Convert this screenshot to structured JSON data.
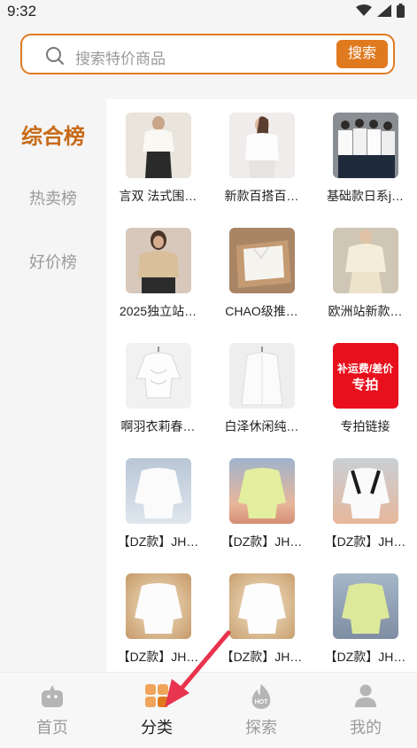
{
  "status": {
    "time": "9:32"
  },
  "search": {
    "placeholder": "搜索特价商品",
    "button_label": "搜索"
  },
  "sidebar": {
    "items": [
      {
        "label": "综合榜",
        "active": true
      },
      {
        "label": "热卖榜",
        "active": false
      },
      {
        "label": "好价榜",
        "active": false
      }
    ]
  },
  "products": [
    {
      "title": "言双 法式围…",
      "thumb": "woman-white-shirt-black-skirt"
    },
    {
      "title": "新款百搭百…",
      "thumb": "woman-white-blouse"
    },
    {
      "title": "基础款日系j…",
      "thumb": "group-students"
    },
    {
      "title": "2025独立站…",
      "thumb": "woman-satin-blouse"
    },
    {
      "title": "CHAO级推…",
      "thumb": "shirt-in-box"
    },
    {
      "title": "欧洲站新款…",
      "thumb": "woman-cream-blouse"
    },
    {
      "title": "啊羽衣莉春…",
      "thumb": "white-ruched-top"
    },
    {
      "title": "白泽休闲纯…",
      "thumb": "white-shirt-hanger"
    },
    {
      "title": "专拍链接",
      "thumb": "promo-red",
      "promo_line1": "补运费/差价",
      "promo_line2": "专拍"
    },
    {
      "title": "【DZ款】JH…",
      "thumb": "white-shirt-blue-bg"
    },
    {
      "title": "【DZ款】JH…",
      "thumb": "lime-shirt-sunset"
    },
    {
      "title": "【DZ款】JH…",
      "thumb": "white-shirt-black-trim"
    },
    {
      "title": "【DZ款】JH…",
      "thumb": "white-shirt-sunset"
    },
    {
      "title": "【DZ款】JH…",
      "thumb": "white-shirt-sunset-2"
    },
    {
      "title": "【DZ款】JH…",
      "thumb": "lime-shirt-blue"
    }
  ],
  "bottom_nav": [
    {
      "label": "首页",
      "icon": "home-icon",
      "active": false
    },
    {
      "label": "分类",
      "icon": "category-icon",
      "active": true
    },
    {
      "label": "探索",
      "icon": "hot-flame-icon",
      "active": false,
      "badge": "HOT"
    },
    {
      "label": "我的",
      "icon": "profile-icon",
      "active": false
    }
  ],
  "colors": {
    "accent": "#e07a1f",
    "active_sidebar": "#c76a17",
    "annotation_arrow": "#e8344e"
  }
}
